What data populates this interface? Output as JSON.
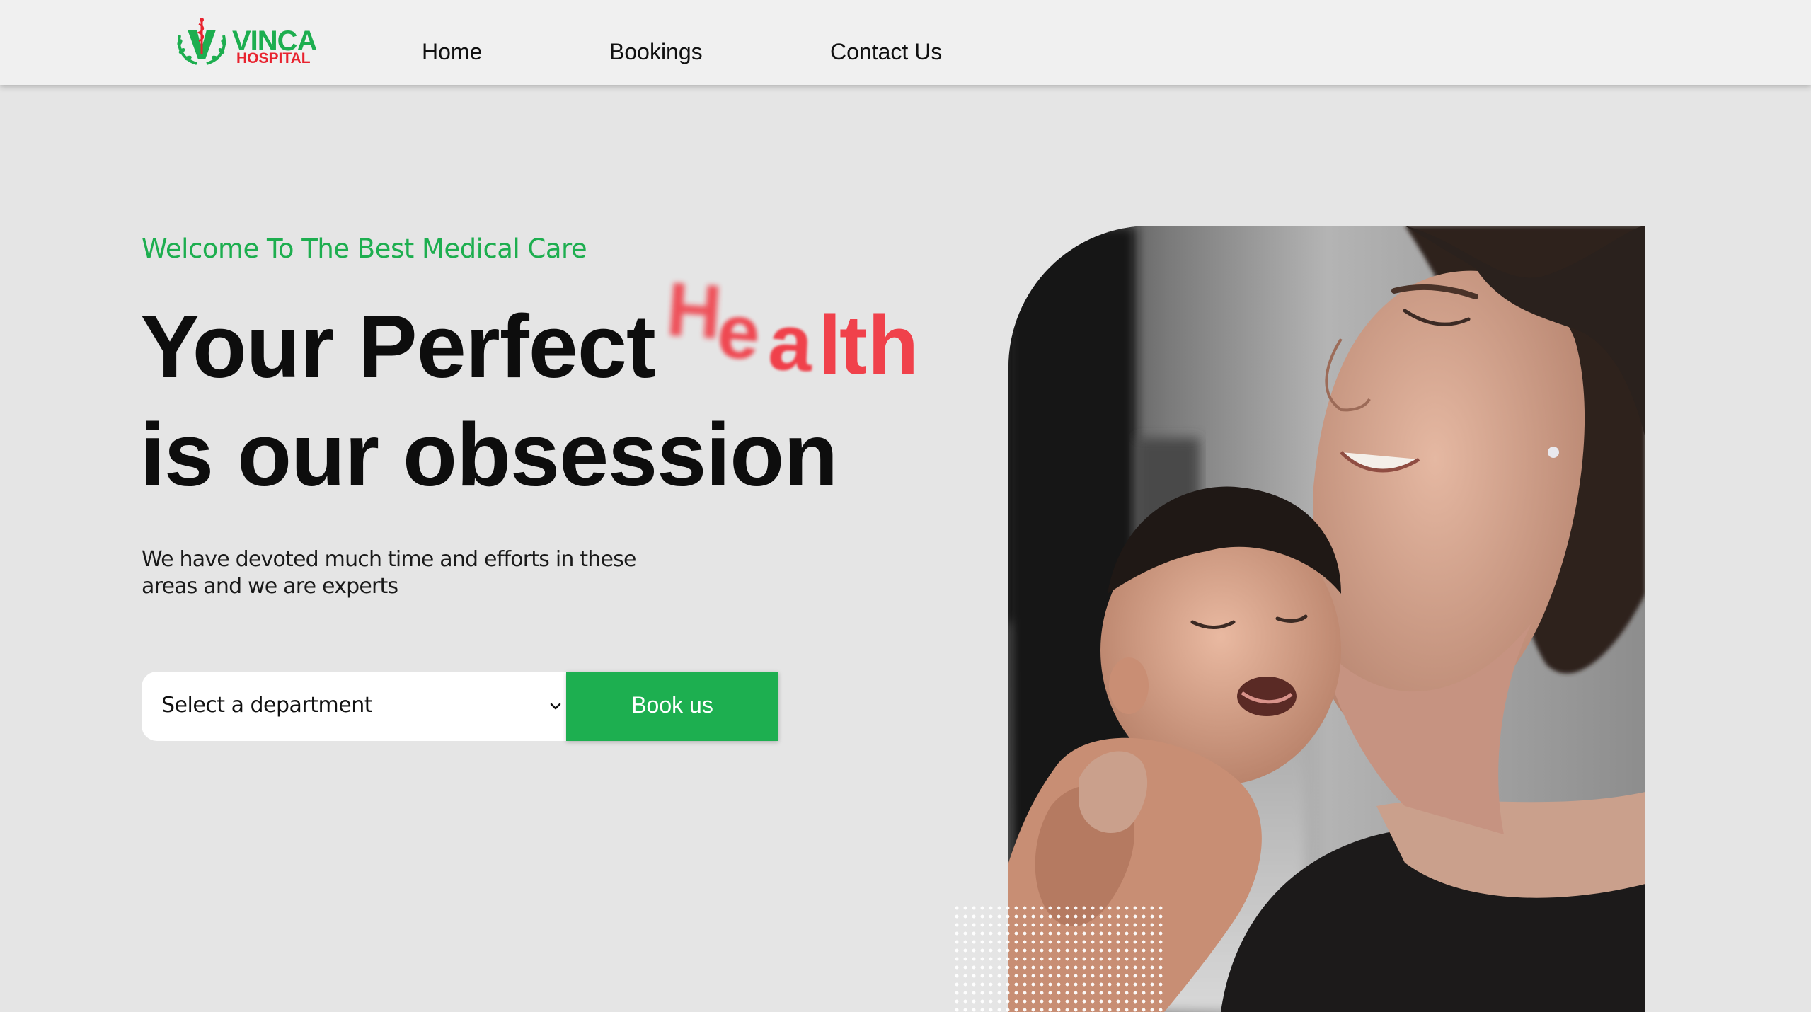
{
  "brand": {
    "name": "VINCA",
    "subname": "HOSPITAL",
    "logo_icon": "caduceus-laurel-v-logo",
    "colors": {
      "primary_green": "#1dae4f",
      "accent_red": "#e8232f"
    }
  },
  "nav": {
    "items": [
      {
        "label": "Home"
      },
      {
        "label": "Bookings"
      },
      {
        "label": "Contact Us"
      }
    ]
  },
  "hero": {
    "eyebrow": "Welcome To The Best Medical Care",
    "headline_line1": "Your Perfect",
    "animated_word": "Health",
    "headline_line2": "is our obsession",
    "description": "We have devoted much time and efforts in these areas and we are experts",
    "colors": {
      "eyebrow": "#1dae4f",
      "animated_word": "#f0414b"
    }
  },
  "booking": {
    "department_select": {
      "selected": "Select a department",
      "icon": "chevron-down-icon"
    },
    "submit_label": "Book us",
    "button_color": "#1daf50"
  },
  "hero_image": {
    "subject": "mother-holding-smiling-baby-photo",
    "decoration": "white-dot-grid"
  }
}
